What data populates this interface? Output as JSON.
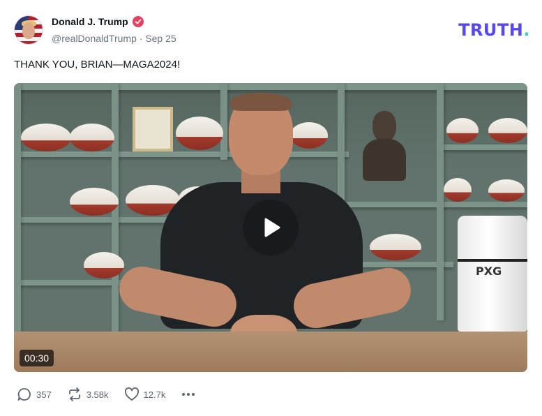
{
  "post": {
    "author": {
      "display_name": "Donald J. Trump",
      "handle": "@realDonaldTrump",
      "separator": "·",
      "date": "Sep 25",
      "avatar_icon": "avatar-flag-portrait",
      "verified_icon": "verified-badge-icon",
      "verified_color": "#e4405f"
    },
    "brand": {
      "logo_text": "TRUTH",
      "logo_dot": ".",
      "logo_color": "#5448ee",
      "dot_color": "#30d5c8"
    },
    "text": "THANK YOU, BRIAN—MAGA2024!",
    "video": {
      "duration": "00:30",
      "play_icon": "play-icon",
      "bag_brand": "PXG"
    },
    "actions": {
      "replies": {
        "icon": "reply-icon",
        "count": "357"
      },
      "retruths": {
        "icon": "retruth-icon",
        "count": "3.58k"
      },
      "likes": {
        "icon": "heart-icon",
        "count": "12.7k"
      },
      "more": {
        "icon": "more-icon"
      }
    }
  }
}
